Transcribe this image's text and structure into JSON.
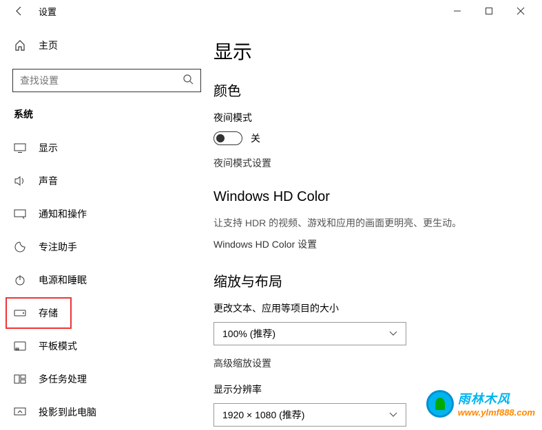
{
  "window": {
    "title": "设置"
  },
  "sidebar": {
    "home_label": "主页",
    "search_placeholder": "查找设置",
    "section_header": "系统",
    "items": [
      {
        "label": "显示",
        "icon": "display"
      },
      {
        "label": "声音",
        "icon": "sound"
      },
      {
        "label": "通知和操作",
        "icon": "notification"
      },
      {
        "label": "专注助手",
        "icon": "focus"
      },
      {
        "label": "电源和睡眠",
        "icon": "power"
      },
      {
        "label": "存储",
        "icon": "storage",
        "highlighted": true
      },
      {
        "label": "平板模式",
        "icon": "tablet"
      },
      {
        "label": "多任务处理",
        "icon": "multitask"
      },
      {
        "label": "投影到此电脑",
        "icon": "project"
      }
    ]
  },
  "main": {
    "page_title": "显示",
    "color_heading": "颜色",
    "night_mode_label": "夜间模式",
    "toggle_state": "关",
    "night_mode_settings": "夜间模式设置",
    "hd_color_heading": "Windows HD Color",
    "hd_color_desc": "让支持 HDR 的视频、游戏和应用的画面更明亮、更生动。",
    "hd_color_link": "Windows HD Color 设置",
    "scale_heading": "缩放与布局",
    "scale_label": "更改文本、应用等项目的大小",
    "scale_value": "100% (推荐)",
    "advanced_scale": "高级缩放设置",
    "resolution_label": "显示分辨率",
    "resolution_value": "1920 × 1080 (推荐)"
  },
  "watermark": {
    "cn": "雨林木风",
    "url": "www.ylmf888.com"
  }
}
